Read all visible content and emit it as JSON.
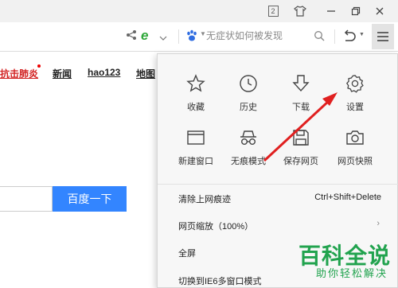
{
  "titlebar": {
    "counter": "2"
  },
  "toolbar": {
    "search_placeholder": "无症状如何被发现"
  },
  "page": {
    "links": {
      "virus": "抗击肺炎",
      "news": "新闻",
      "hao": "hao123",
      "map": "地图"
    },
    "search_button": "百度一下"
  },
  "menu": {
    "grid": {
      "favorites": "收藏",
      "history": "历史",
      "downloads": "下载",
      "settings": "设置",
      "new_window": "新建窗口",
      "incognito": "无痕模式",
      "save_page": "保存网页",
      "snapshot": "网页快照"
    },
    "list": {
      "clear_traces": "清除上网痕迹",
      "clear_shortcut": "Ctrl+Shift+Delete",
      "zoom": "网页缩放（100%）",
      "fullscreen": "全屏",
      "ie6_switch": "切换到IE6多窗口模式"
    }
  },
  "watermark": {
    "main": "百科全说",
    "sub": "助你轻松解决"
  },
  "colors": {
    "accent_blue": "#3385ff",
    "annotation_red": "#e02020",
    "watermark_green": "#21a34e",
    "hot_link_red": "#d22222"
  }
}
